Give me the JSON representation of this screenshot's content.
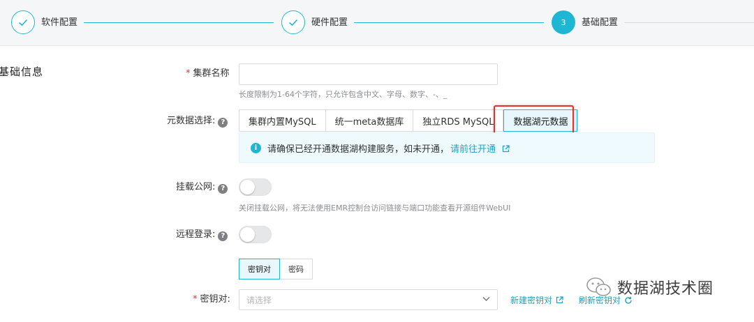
{
  "steps": [
    {
      "label": "软件配置",
      "state": "done",
      "icon": "check-icon"
    },
    {
      "label": "硬件配置",
      "state": "done",
      "icon": "check-icon"
    },
    {
      "label": "基础配置",
      "state": "active",
      "number": "3"
    }
  ],
  "section": {
    "title": "基础信息"
  },
  "cluster_name": {
    "label": "集群名称",
    "required_mark": "*",
    "value": "",
    "hint": "长度限制为1-64个字符，只允许包含中文、字母、数字、-、_"
  },
  "metadata": {
    "label": "元数据选择:",
    "help": "?",
    "options": [
      "集群内置MySQL",
      "统一meta数据库",
      "独立RDS MySQL",
      "数据湖元数据"
    ],
    "selected": "数据湖元数据",
    "info_text": "请确保已经开通数据湖构建服务，如未开通，",
    "info_link": "请前往开通",
    "info_icon": "i"
  },
  "public_network": {
    "label": "挂载公网:",
    "help": "?",
    "enabled": false,
    "hint": "关闭挂载公网，将无法使用EMR控制台访问链接与端口功能查看开源组件WebUI"
  },
  "remote_login": {
    "label": "远程登录:",
    "help": "?",
    "enabled": false
  },
  "auth_mode": {
    "options": [
      "密钥对",
      "密码"
    ],
    "selected": "密钥对"
  },
  "key_pair": {
    "label": "密钥对:",
    "required_mark": "*",
    "placeholder": "请选择",
    "create_link": "新建密钥对",
    "refresh_link": "刷新密钥对"
  },
  "watermark": {
    "text": "数据湖技术圈"
  },
  "colors": {
    "accent": "#1fb6d4",
    "highlight": "#e0322e",
    "required": "#e0332e"
  }
}
